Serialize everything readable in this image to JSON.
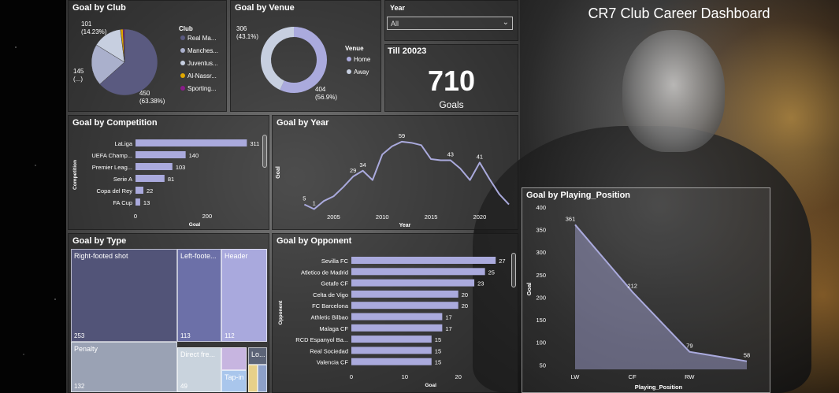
{
  "dashboard": {
    "title": "CR7 Club Career Dashboard"
  },
  "slicer": {
    "label": "Year",
    "value": "All"
  },
  "card": {
    "title": "Till 20023",
    "value": "710",
    "label": "Goals"
  },
  "icons": {
    "dropdown": "chevron-down-icon",
    "player_photo": "player-photo"
  },
  "colors": {
    "series": "#aaaadd",
    "club_real_madrid": "#5a5a80",
    "club_manchester": "#aab0cc",
    "club_juventus": "#c7cfe0",
    "club_al_nassr": "#e0a800",
    "club_sporting": "#8a1c8a"
  },
  "chart_data": [
    {
      "id": "club",
      "type": "pie",
      "title": "Goal by Club",
      "legend_title": "Club",
      "legend_position": "right",
      "categories": [
        "Real Ma...",
        "Manches...",
        "Juventus...",
        "Al-Nassr...",
        "Sporting..."
      ],
      "values": [
        450,
        145,
        101,
        9,
        5
      ],
      "data_labels": [
        "450\n(63.38%)",
        "145\n(...)",
        "101\n(14.23%)"
      ]
    },
    {
      "id": "venue",
      "type": "pie",
      "title": "Goal by Venue",
      "legend_title": "Venue",
      "legend_position": "right",
      "categories": [
        "Home",
        "Away"
      ],
      "values": [
        404,
        306
      ],
      "data_labels": [
        "404\n(56.9%)",
        "306\n(43.1%)"
      ]
    },
    {
      "id": "competition",
      "type": "bar",
      "title": "Goal by Competition",
      "xlabel": "Goal",
      "ylabel": "Competition",
      "categories": [
        "LaLiga",
        "UEFA Champ...",
        "Premier Leag...",
        "Serie A",
        "Copa del Rey",
        "FA Cup"
      ],
      "values": [
        311,
        140,
        103,
        81,
        22,
        13
      ],
      "xticks": [
        0,
        200
      ],
      "xlim": [
        0,
        330
      ]
    },
    {
      "id": "year",
      "type": "line",
      "title": "Goal by Year",
      "xlabel": "Year",
      "ylabel": "Goal",
      "x": [
        2002,
        2003,
        2004,
        2005,
        2006,
        2007,
        2008,
        2009,
        2010,
        2011,
        2012,
        2013,
        2014,
        2015,
        2016,
        2017,
        2018,
        2019,
        2020,
        2021,
        2022,
        2023
      ],
      "values": [
        5,
        1,
        8,
        12,
        20,
        29,
        34,
        26,
        48,
        55,
        59,
        58,
        56,
        44,
        43,
        43,
        36,
        26,
        41,
        27,
        14,
        5
      ],
      "point_labels": {
        "2002": "5",
        "2003": "1",
        "2007": "29",
        "2008": "34",
        "2012": "59",
        "2017": "43",
        "2020": "41"
      },
      "xticks": [
        2005,
        2010,
        2015,
        2020
      ],
      "xlim": [
        2001,
        2023
      ],
      "ylim": [
        0,
        65
      ]
    },
    {
      "id": "type",
      "type": "treemap",
      "title": "Goal by Type",
      "categories": [
        "Right-footed shot",
        "Left-foote...",
        "Header",
        "Penalty",
        "Direct fre...",
        "Tap-in",
        "Lo..."
      ],
      "values": [
        253,
        113,
        112,
        132,
        49,
        0,
        0
      ]
    },
    {
      "id": "opponent",
      "type": "bar",
      "title": "Goal by Opponent",
      "xlabel": "Goal",
      "ylabel": "Opponent",
      "categories": [
        "Sevilla FC",
        "Atletico de Madrid",
        "Getafe CF",
        "Celta de Vigo",
        "FC Barcelona",
        "Athletic Bilbao",
        "Malaga CF",
        "RCD Espanyol Ba...",
        "Real Sociedad",
        "Valencia CF"
      ],
      "values": [
        27,
        25,
        23,
        20,
        20,
        17,
        17,
        15,
        15,
        15
      ],
      "xticks": [
        0,
        10,
        20
      ],
      "xlim": [
        0,
        28
      ]
    },
    {
      "id": "position",
      "type": "area",
      "title": "Goal by Playing_Position",
      "xlabel": "Playing_Position",
      "ylabel": "Goal",
      "categories": [
        "LW",
        "CF",
        "RW",
        ""
      ],
      "values": [
        361,
        212,
        79,
        58
      ],
      "yticks": [
        50,
        100,
        150,
        200,
        250,
        300,
        350,
        400
      ],
      "ylim": [
        40,
        400
      ]
    }
  ]
}
